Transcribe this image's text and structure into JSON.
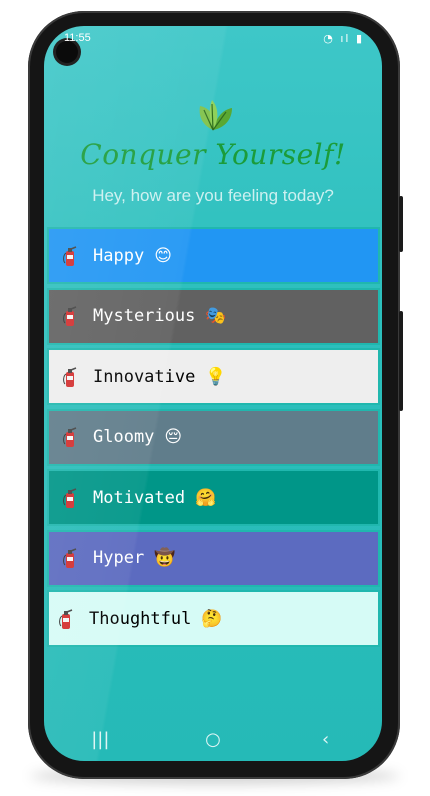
{
  "status_bar": {
    "time": "11:55",
    "icons": "◔ ıl ▮"
  },
  "header": {
    "logo_icon": "leaf-icon",
    "title": "Conquer Yourself!",
    "subtitle": "Hey, how are you feeling today?",
    "title_color": "#1b9c3a"
  },
  "moods": [
    {
      "label": "Happy",
      "emoji": "😊",
      "bg": "#2196f3",
      "fg": "#ffffff"
    },
    {
      "label": "Mysterious",
      "emoji": "🎭",
      "bg": "#616161",
      "fg": "#ffffff"
    },
    {
      "label": "Innovative",
      "emoji": "💡",
      "bg": "#eeeeee",
      "fg": "#000000"
    },
    {
      "label": "Gloomy",
      "emoji": "😔",
      "bg": "#607d8b",
      "fg": "#ffffff"
    },
    {
      "label": "Motivated",
      "emoji": "🤗",
      "bg": "#009688",
      "fg": "#ffffff"
    },
    {
      "label": "Hyper",
      "emoji": "🤠",
      "bg": "#5c6bc0",
      "fg": "#ffffff"
    },
    {
      "label": "Thoughtful",
      "emoji": "🤔",
      "bg": "#d6fbf6",
      "fg": "#000000"
    }
  ],
  "nav_bar": {
    "recents": "|||",
    "home": "○",
    "back": "‹"
  }
}
